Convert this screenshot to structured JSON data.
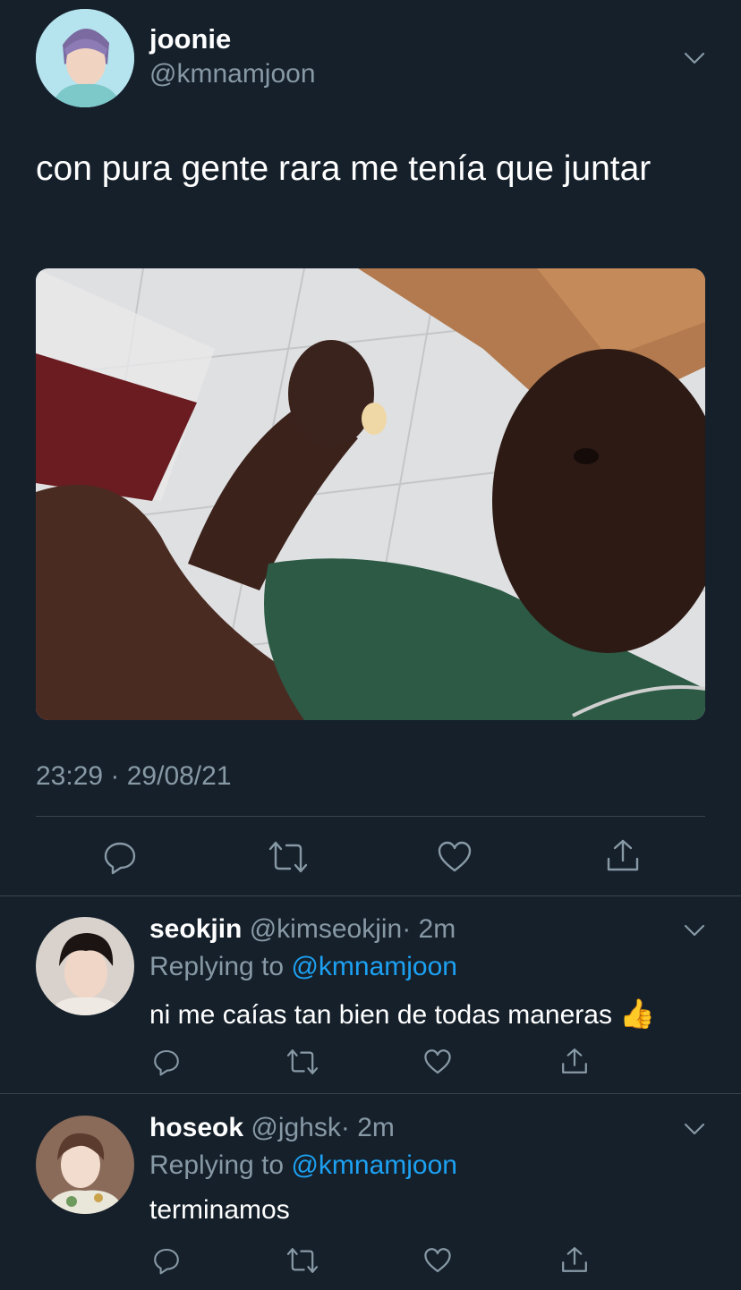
{
  "main_tweet": {
    "display_name": "joonie",
    "handle": "@kmnamjoon",
    "text": "con pura gente rara me tenía que juntar",
    "timestamp": "23:29 · 29/08/21",
    "actions": [
      "reply-icon",
      "retweet-icon",
      "like-icon",
      "share-icon"
    ]
  },
  "replies": [
    {
      "display_name": "seokjin",
      "handle": "@kimseokjin",
      "time": "· 2m",
      "replying_label": "Replying to",
      "replying_to": "@kmnamjoon",
      "text": "ni me caías tan bien de todas maneras",
      "emoji": "👍"
    },
    {
      "display_name": "hoseok",
      "handle": "@jghsk",
      "time": "· 2m",
      "replying_label": "Replying to",
      "replying_to": "@kmnamjoon",
      "text": "terminamos"
    }
  ],
  "colors": {
    "background": "#15202b",
    "muted": "#8899a6",
    "link": "#1da1f2",
    "divider": "#38444d"
  }
}
